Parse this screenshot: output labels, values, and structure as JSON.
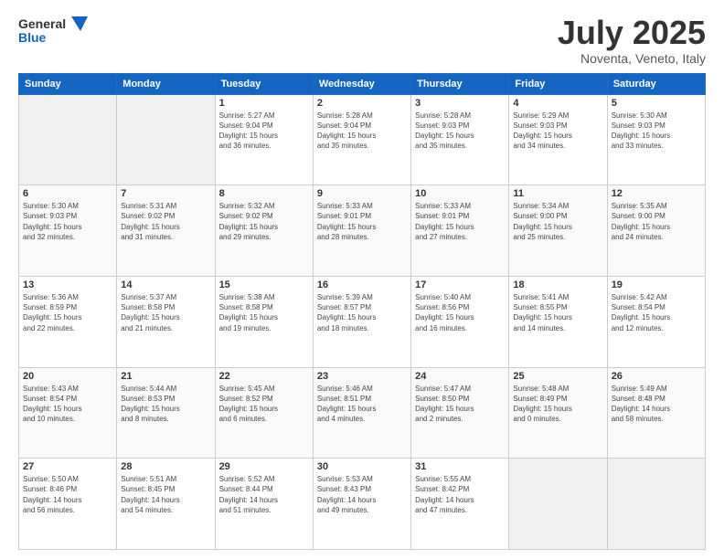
{
  "header": {
    "logo_general": "General",
    "logo_blue": "Blue",
    "month_title": "July 2025",
    "location": "Noventa, Veneto, Italy"
  },
  "days_of_week": [
    "Sunday",
    "Monday",
    "Tuesday",
    "Wednesday",
    "Thursday",
    "Friday",
    "Saturday"
  ],
  "weeks": [
    [
      {
        "day": "",
        "info": ""
      },
      {
        "day": "",
        "info": ""
      },
      {
        "day": "1",
        "info": "Sunrise: 5:27 AM\nSunset: 9:04 PM\nDaylight: 15 hours\nand 36 minutes."
      },
      {
        "day": "2",
        "info": "Sunrise: 5:28 AM\nSunset: 9:04 PM\nDaylight: 15 hours\nand 35 minutes."
      },
      {
        "day": "3",
        "info": "Sunrise: 5:28 AM\nSunset: 9:03 PM\nDaylight: 15 hours\nand 35 minutes."
      },
      {
        "day": "4",
        "info": "Sunrise: 5:29 AM\nSunset: 9:03 PM\nDaylight: 15 hours\nand 34 minutes."
      },
      {
        "day": "5",
        "info": "Sunrise: 5:30 AM\nSunset: 9:03 PM\nDaylight: 15 hours\nand 33 minutes."
      }
    ],
    [
      {
        "day": "6",
        "info": "Sunrise: 5:30 AM\nSunset: 9:03 PM\nDaylight: 15 hours\nand 32 minutes."
      },
      {
        "day": "7",
        "info": "Sunrise: 5:31 AM\nSunset: 9:02 PM\nDaylight: 15 hours\nand 31 minutes."
      },
      {
        "day": "8",
        "info": "Sunrise: 5:32 AM\nSunset: 9:02 PM\nDaylight: 15 hours\nand 29 minutes."
      },
      {
        "day": "9",
        "info": "Sunrise: 5:33 AM\nSunset: 9:01 PM\nDaylight: 15 hours\nand 28 minutes."
      },
      {
        "day": "10",
        "info": "Sunrise: 5:33 AM\nSunset: 9:01 PM\nDaylight: 15 hours\nand 27 minutes."
      },
      {
        "day": "11",
        "info": "Sunrise: 5:34 AM\nSunset: 9:00 PM\nDaylight: 15 hours\nand 25 minutes."
      },
      {
        "day": "12",
        "info": "Sunrise: 5:35 AM\nSunset: 9:00 PM\nDaylight: 15 hours\nand 24 minutes."
      }
    ],
    [
      {
        "day": "13",
        "info": "Sunrise: 5:36 AM\nSunset: 8:59 PM\nDaylight: 15 hours\nand 22 minutes."
      },
      {
        "day": "14",
        "info": "Sunrise: 5:37 AM\nSunset: 8:58 PM\nDaylight: 15 hours\nand 21 minutes."
      },
      {
        "day": "15",
        "info": "Sunrise: 5:38 AM\nSunset: 8:58 PM\nDaylight: 15 hours\nand 19 minutes."
      },
      {
        "day": "16",
        "info": "Sunrise: 5:39 AM\nSunset: 8:57 PM\nDaylight: 15 hours\nand 18 minutes."
      },
      {
        "day": "17",
        "info": "Sunrise: 5:40 AM\nSunset: 8:56 PM\nDaylight: 15 hours\nand 16 minutes."
      },
      {
        "day": "18",
        "info": "Sunrise: 5:41 AM\nSunset: 8:55 PM\nDaylight: 15 hours\nand 14 minutes."
      },
      {
        "day": "19",
        "info": "Sunrise: 5:42 AM\nSunset: 8:54 PM\nDaylight: 15 hours\nand 12 minutes."
      }
    ],
    [
      {
        "day": "20",
        "info": "Sunrise: 5:43 AM\nSunset: 8:54 PM\nDaylight: 15 hours\nand 10 minutes."
      },
      {
        "day": "21",
        "info": "Sunrise: 5:44 AM\nSunset: 8:53 PM\nDaylight: 15 hours\nand 8 minutes."
      },
      {
        "day": "22",
        "info": "Sunrise: 5:45 AM\nSunset: 8:52 PM\nDaylight: 15 hours\nand 6 minutes."
      },
      {
        "day": "23",
        "info": "Sunrise: 5:46 AM\nSunset: 8:51 PM\nDaylight: 15 hours\nand 4 minutes."
      },
      {
        "day": "24",
        "info": "Sunrise: 5:47 AM\nSunset: 8:50 PM\nDaylight: 15 hours\nand 2 minutes."
      },
      {
        "day": "25",
        "info": "Sunrise: 5:48 AM\nSunset: 8:49 PM\nDaylight: 15 hours\nand 0 minutes."
      },
      {
        "day": "26",
        "info": "Sunrise: 5:49 AM\nSunset: 8:48 PM\nDaylight: 14 hours\nand 58 minutes."
      }
    ],
    [
      {
        "day": "27",
        "info": "Sunrise: 5:50 AM\nSunset: 8:46 PM\nDaylight: 14 hours\nand 56 minutes."
      },
      {
        "day": "28",
        "info": "Sunrise: 5:51 AM\nSunset: 8:45 PM\nDaylight: 14 hours\nand 54 minutes."
      },
      {
        "day": "29",
        "info": "Sunrise: 5:52 AM\nSunset: 8:44 PM\nDaylight: 14 hours\nand 51 minutes."
      },
      {
        "day": "30",
        "info": "Sunrise: 5:53 AM\nSunset: 8:43 PM\nDaylight: 14 hours\nand 49 minutes."
      },
      {
        "day": "31",
        "info": "Sunrise: 5:55 AM\nSunset: 8:42 PM\nDaylight: 14 hours\nand 47 minutes."
      },
      {
        "day": "",
        "info": ""
      },
      {
        "day": "",
        "info": ""
      }
    ]
  ]
}
